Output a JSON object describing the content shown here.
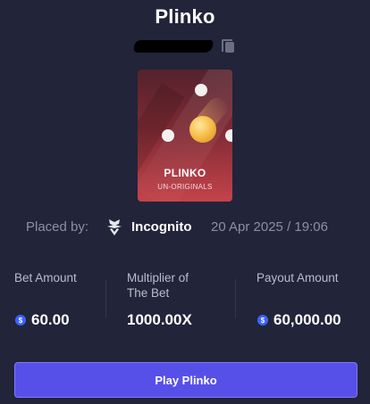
{
  "modal": {
    "title": "Plinko"
  },
  "game_card": {
    "name": "PLINKO",
    "tag": "UN-ORIGINALS",
    "colors": {
      "top": "#55222d",
      "bottom": "#c4434b",
      "ball": "#f5c14b",
      "peg": "#f4f1ee"
    }
  },
  "placed": {
    "label": "Placed by:",
    "user_icon": "incognito-icon",
    "user": "Incognito",
    "datetime": "20 Apr 2025 / 19:06"
  },
  "stats": {
    "bet": {
      "label": "Bet Amount",
      "value": "60.00",
      "currency_icon": "dollar-coin-icon"
    },
    "multiplier": {
      "label_line1": "Multiplier of",
      "label_line2": "The Bet",
      "value": "1000.00X"
    },
    "payout": {
      "label": "Payout Amount",
      "value": "60,000.00",
      "currency_icon": "dollar-coin-icon"
    }
  },
  "actions": {
    "play_label": "Play Plinko"
  },
  "colors": {
    "background": "#222439",
    "accent": "#5650e8",
    "coin": "#3b63ff",
    "muted_text": "#8b8fa6"
  }
}
